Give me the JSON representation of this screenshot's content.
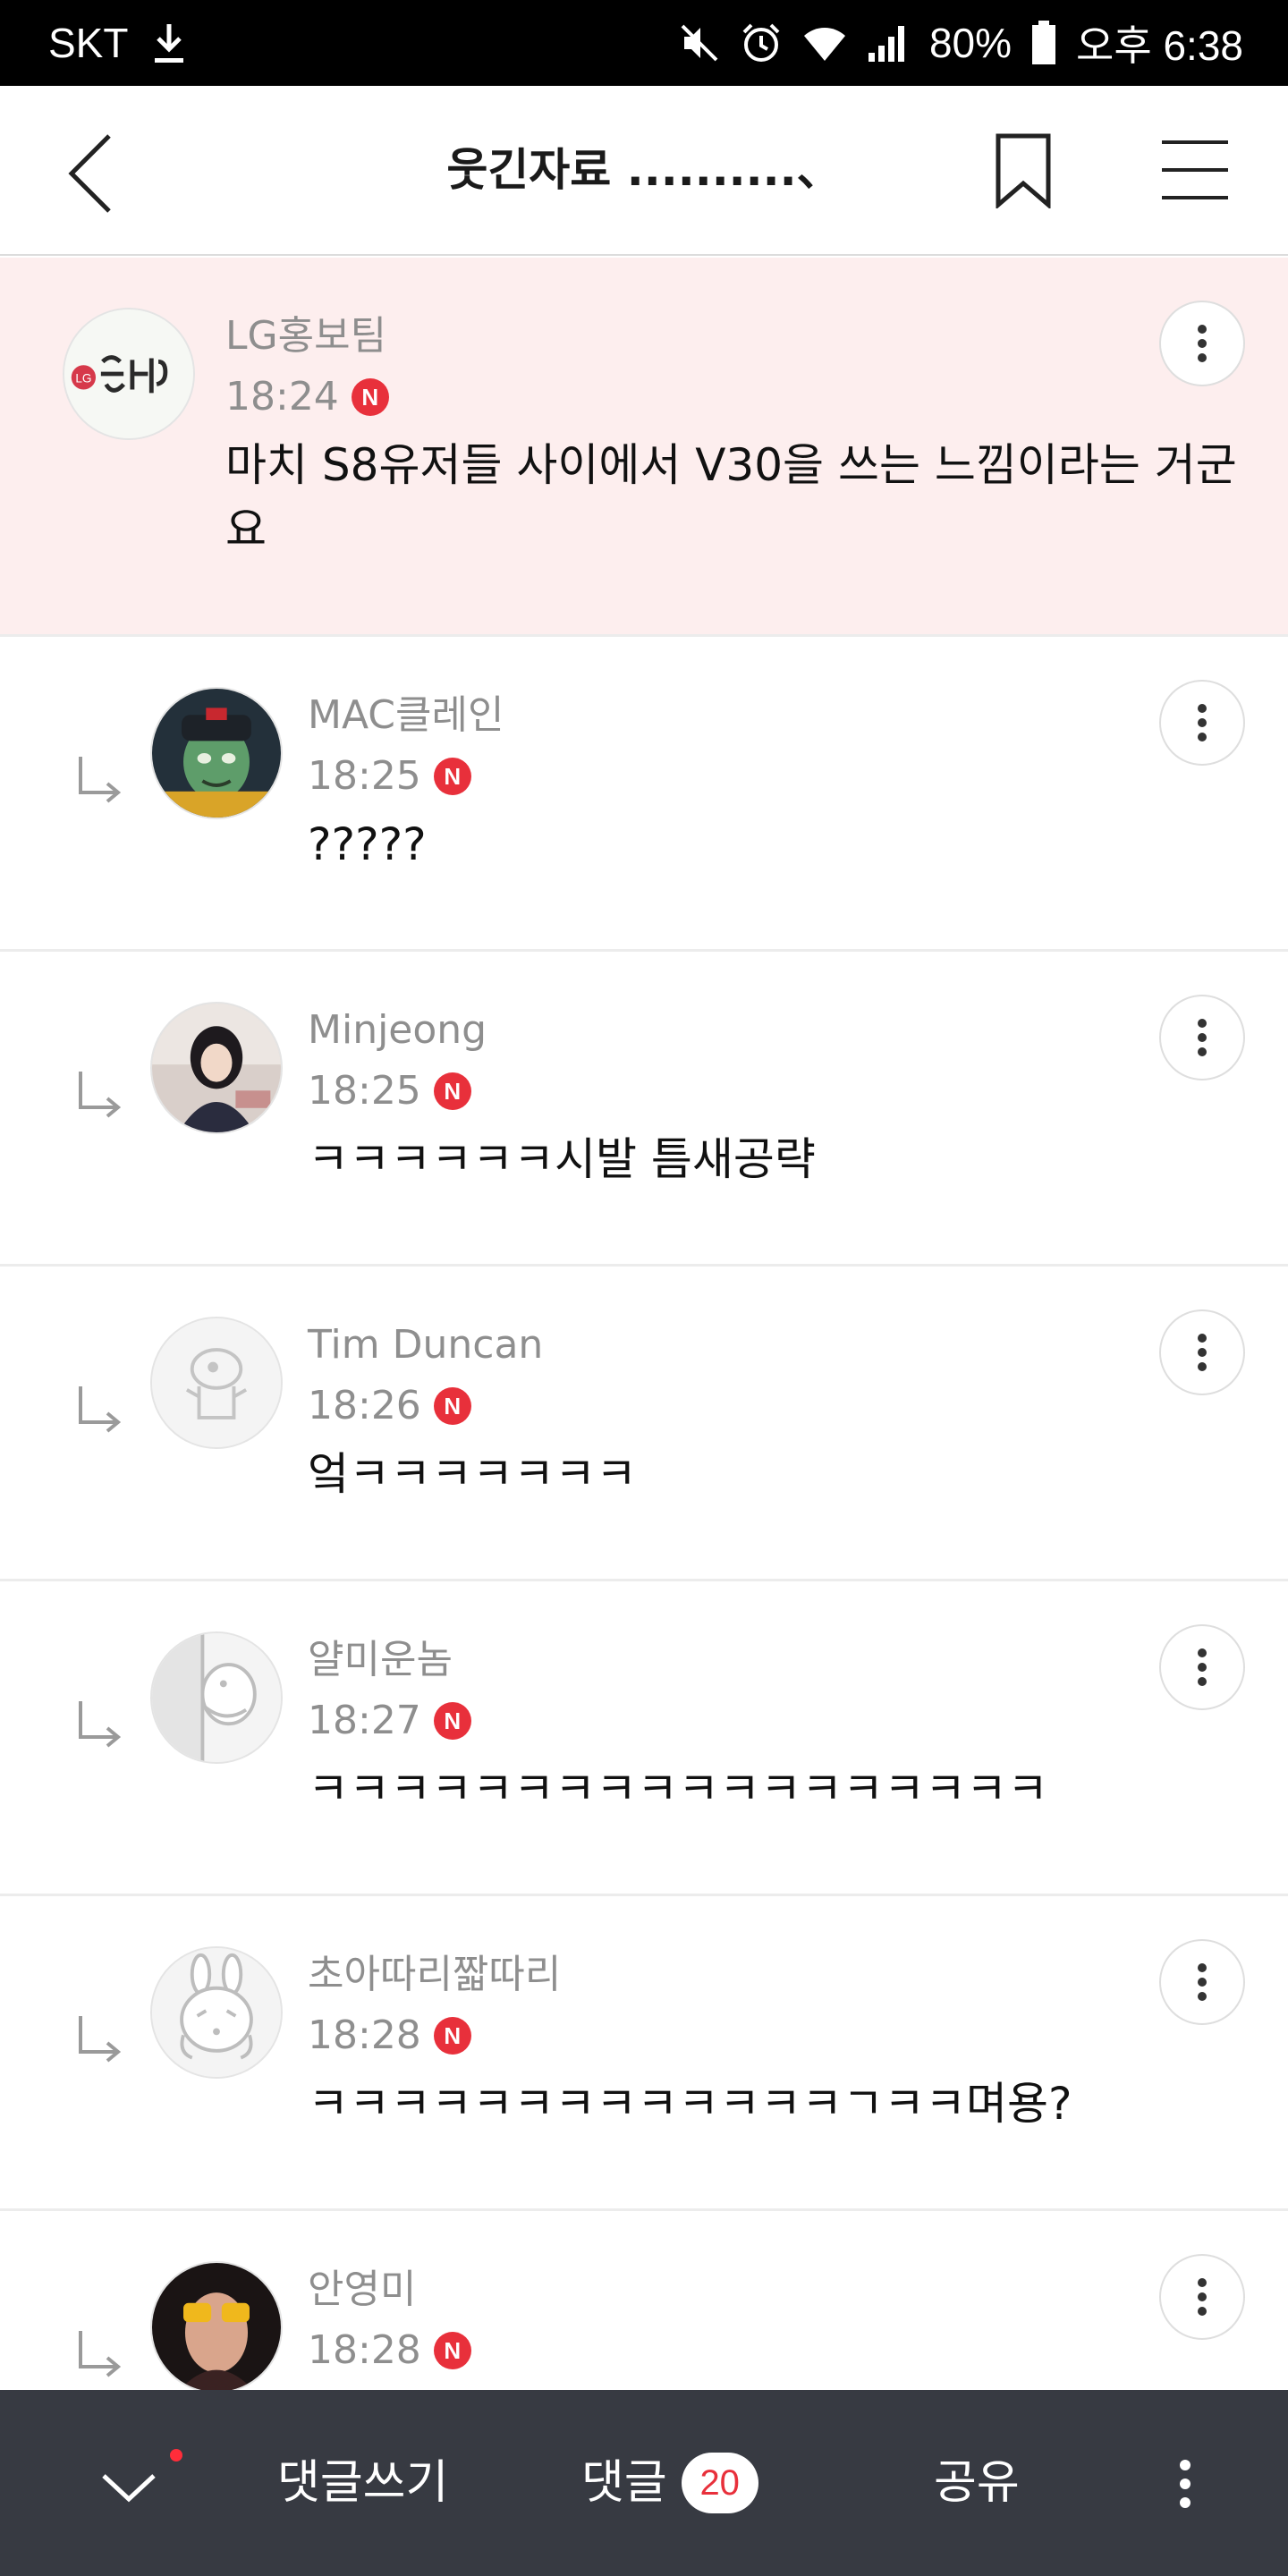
{
  "status_bar": {
    "carrier": "SKT",
    "battery": "80%",
    "time": "오후 6:38",
    "icons": [
      "download-icon",
      "mute-icon",
      "alarm-icon",
      "wifi-icon",
      "signal-icon",
      "battery-icon"
    ]
  },
  "header": {
    "title": "웃긴자료 ..........、",
    "icons": [
      "back-icon",
      "bookmark-icon",
      "hamburger-menu-icon"
    ]
  },
  "comments": [
    {
      "author": "LG홍보팀",
      "time": "18:24",
      "badge": "N",
      "text": "마치 S8유저들 사이에서 V30을 쓰는 느낌이라는 거군요",
      "highlighted": true,
      "reply": false,
      "avatar": "lg-logo-avatar"
    },
    {
      "author": "MAC클레인",
      "time": "18:25",
      "badge": "N",
      "text": "?????",
      "reply": true,
      "avatar": "cartoon-character-avatar"
    },
    {
      "author": "Minjeong",
      "time": "18:25",
      "badge": "N",
      "text": "ㅋㅋㅋㅋㅋㅋ시발 틈새공략",
      "reply": true,
      "avatar": "photo-avatar"
    },
    {
      "author": "Tim Duncan",
      "time": "18:26",
      "badge": "N",
      "text": "엌ㅋㅋㅋㅋㅋㅋㅋ",
      "reply": true,
      "avatar": "default-character-avatar"
    },
    {
      "author": "얄미운놈",
      "time": "18:27",
      "badge": "N",
      "text": "ㅋㅋㅋㅋㅋㅋㅋㅋㅋㅋㅋㅋㅋㅋㅋㅋㅋㅋ",
      "reply": true,
      "avatar": "peeking-character-avatar"
    },
    {
      "author": "초아따리짧따리",
      "time": "18:28",
      "badge": "N",
      "text": "ㅋㅋㅋㅋㅋㅋㅋㅋㅋㅋㅋㅋㅋㄱㅋㅋ며용?",
      "reply": true,
      "avatar": "rabbit-character-avatar"
    },
    {
      "author": "안영미",
      "time": "18:28",
      "badge": "N",
      "text": "",
      "reply": true,
      "avatar": "photo-avatar"
    }
  ],
  "bottom_bar": {
    "write_comment": "댓글쓰기",
    "comments_label": "댓글",
    "comment_count": "20",
    "share": "공유",
    "colors": {
      "bar": "#373a42",
      "accent": "#e8303b"
    }
  }
}
